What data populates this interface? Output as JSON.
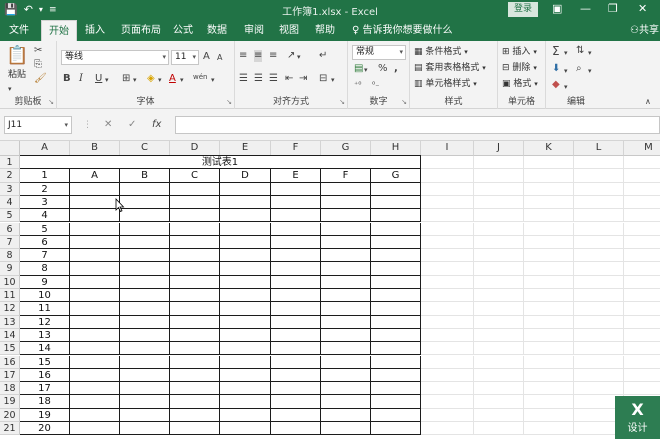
{
  "window": {
    "title": "工作簿1.xlsx - Excel",
    "login_label": "登录",
    "minimize": "—",
    "restore": "❐",
    "close": "✕"
  },
  "quick_access": {
    "save_icon": "save-icon",
    "undo_icon": "undo-icon",
    "customize_icon": "customize-icon"
  },
  "tabs": [
    {
      "label": "文件"
    },
    {
      "label": "开始"
    },
    {
      "label": "插入"
    },
    {
      "label": "页面布局"
    },
    {
      "label": "公式"
    },
    {
      "label": "数据"
    },
    {
      "label": "审阅"
    },
    {
      "label": "视图"
    },
    {
      "label": "帮助"
    }
  ],
  "active_tab": "开始",
  "tell_me": "告诉我你想要做什么",
  "share": "共享",
  "ribbon": {
    "clipboard": {
      "paste_label": "粘贴",
      "group_label": "剪贴板"
    },
    "font": {
      "font_name": "等线",
      "font_size": "11",
      "grow": "A",
      "shrink": "A",
      "bold": "B",
      "italic": "I",
      "underline": "U",
      "wen": "wén",
      "group_label": "字体"
    },
    "alignment": {
      "group_label": "对齐方式"
    },
    "number": {
      "format": "常规",
      "percent": "%",
      "comma": ",",
      "group_label": "数字"
    },
    "styles": {
      "conditional": "条件格式",
      "table": "套用表格格式",
      "cell_styles": "单元格样式",
      "group_label": "样式"
    },
    "cells": {
      "insert": "插入",
      "delete": "删除",
      "format": "格式",
      "group_label": "单元格"
    },
    "editing": {
      "sum": "Σ",
      "group_label": "编辑"
    }
  },
  "formula_bar": {
    "name_box": "J11",
    "cancel": "✕",
    "enter": "✓",
    "fx": "fx",
    "formula": ""
  },
  "grid": {
    "columns": [
      "A",
      "B",
      "C",
      "D",
      "E",
      "F",
      "G",
      "H",
      "I",
      "J",
      "K",
      "L",
      "M"
    ],
    "rows": [
      "1",
      "2",
      "3",
      "4",
      "5",
      "6",
      "7",
      "8",
      "9",
      "10",
      "11",
      "12",
      "13",
      "14",
      "15",
      "16",
      "17",
      "18",
      "19",
      "20",
      "21"
    ],
    "table_title": "测试表1",
    "header_row": [
      "1",
      "A",
      "B",
      "C",
      "D",
      "E",
      "F",
      "G"
    ],
    "column_a_values": [
      "2",
      "3",
      "4",
      "5",
      "6",
      "7",
      "8",
      "9",
      "10",
      "11",
      "12",
      "13",
      "14",
      "15",
      "16",
      "17",
      "18",
      "19",
      "20"
    ]
  },
  "badge": {
    "label": "设计"
  }
}
